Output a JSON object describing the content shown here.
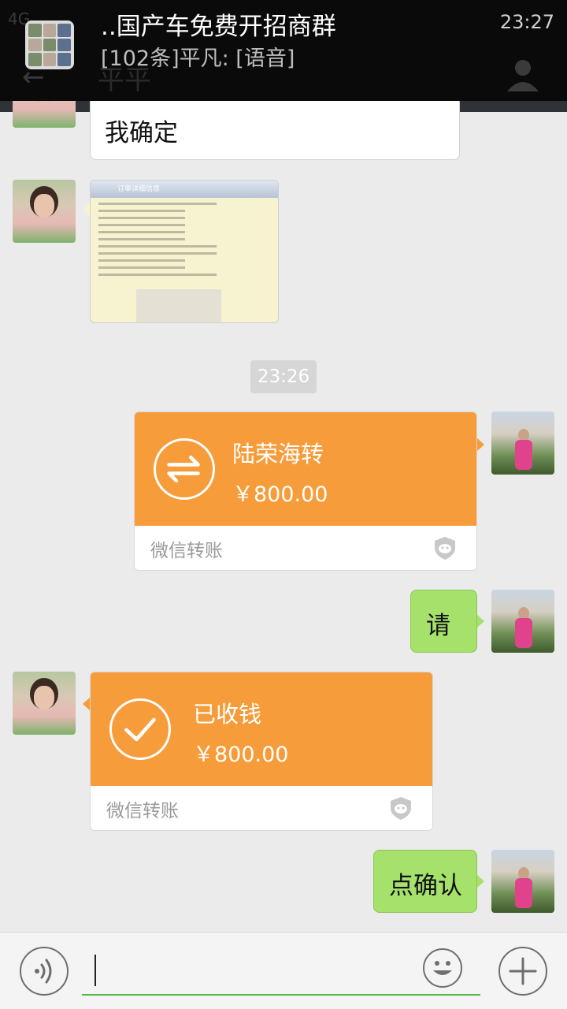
{
  "notification": {
    "group_name": "..国产车免费开招商群",
    "preview": "[102条]平凡: [语音]",
    "time": "23:27"
  },
  "status_bar": {
    "network": "4G"
  },
  "chat_header": {
    "title": "平平"
  },
  "messages": [
    {
      "sender": "other",
      "type": "text",
      "text": "我确定"
    },
    {
      "sender": "other",
      "type": "image",
      "header": "订单详细信息"
    },
    {
      "type": "timestamp",
      "text": "23:26"
    },
    {
      "sender": "me",
      "type": "transfer",
      "title": "陆荣海转",
      "amount": "￥800.00",
      "brand": "微信转账"
    },
    {
      "sender": "me",
      "type": "text",
      "text": "请"
    },
    {
      "sender": "other",
      "type": "transfer",
      "title": "已收钱",
      "amount": "￥800.00",
      "brand": "微信转账"
    },
    {
      "sender": "me",
      "type": "text",
      "text": "点确认"
    }
  ],
  "input_bar": {
    "value": ""
  },
  "colors": {
    "bubble_green": "#a6e16c",
    "transfer_orange": "#f79c3a",
    "chat_bg": "#ebebeb",
    "input_underline": "#56b94a"
  }
}
